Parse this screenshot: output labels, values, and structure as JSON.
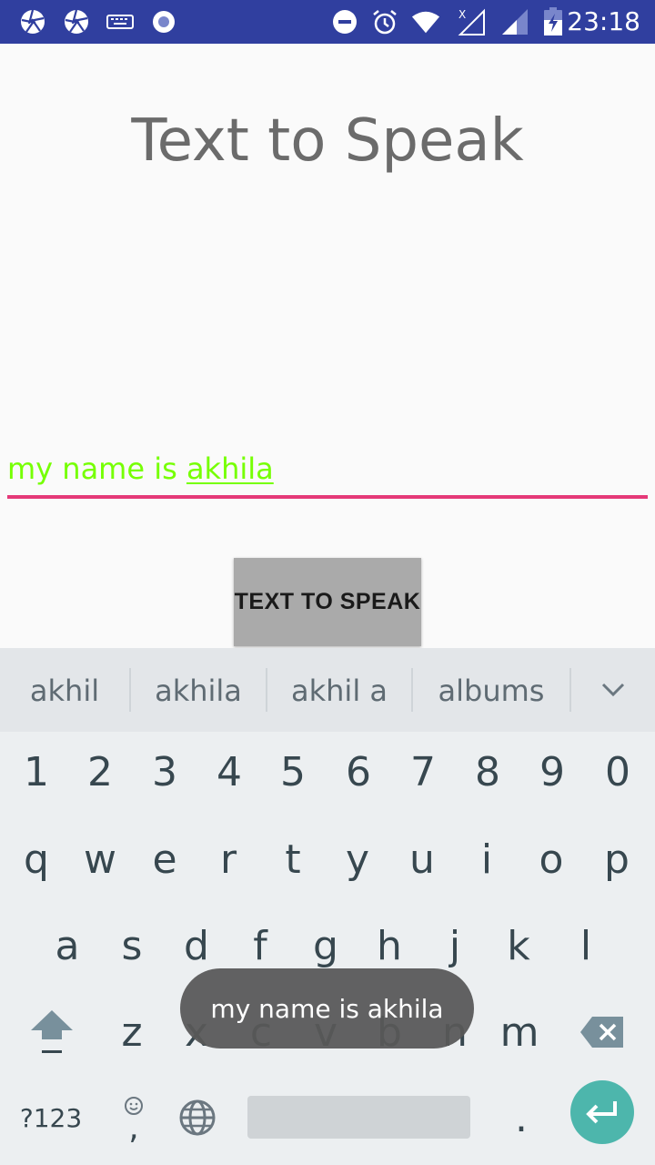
{
  "status_bar": {
    "time": "23:18",
    "icons": [
      "aperture-icon",
      "aperture-icon",
      "keyboard-icon",
      "record-icon",
      "do-not-disturb-icon",
      "alarm-icon",
      "wifi-icon",
      "no-data-signal-icon",
      "signal-icon",
      "battery-charging-icon"
    ],
    "background_color": "#303f9f"
  },
  "app": {
    "title": "Text to Speak",
    "input_plain": "my name is ",
    "input_underlined": "akhila",
    "input_color": "#76ff03",
    "underline_color": "#e53978",
    "button_label": "TEXT TO SPEAK"
  },
  "keyboard": {
    "suggestions": [
      "akhil",
      "akhila",
      "akhil a",
      "albums"
    ],
    "number_row": [
      "1",
      "2",
      "3",
      "4",
      "5",
      "6",
      "7",
      "8",
      "9",
      "0"
    ],
    "row1": [
      "q",
      "w",
      "e",
      "r",
      "t",
      "y",
      "u",
      "i",
      "o",
      "p"
    ],
    "row2": [
      "a",
      "s",
      "d",
      "f",
      "g",
      "h",
      "j",
      "k",
      "l"
    ],
    "row3": [
      "z",
      "x",
      "c",
      "v",
      "b",
      "n",
      "m"
    ],
    "symbols_label": "?123",
    "comma_label": ",",
    "period_label": ".",
    "enter_color": "#4db6ac"
  },
  "toast": {
    "message": "my name is akhila"
  }
}
